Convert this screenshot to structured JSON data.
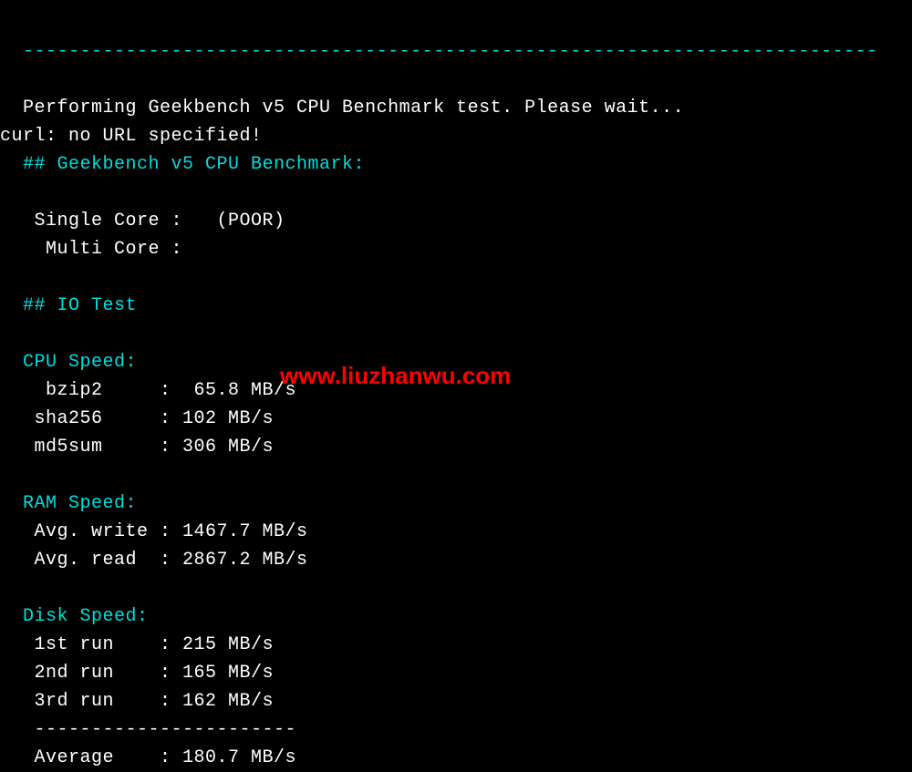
{
  "separator": "  ---------------------------------------------------------------------------",
  "intro": {
    "performing": "  Performing Geekbench v5 CPU Benchmark test. Please wait...",
    "curl_error": "curl: no URL specified!"
  },
  "sections": {
    "geekbench_header": "  ## Geekbench v5 CPU Benchmark:",
    "single_core_label": "   Single Core : ",
    "single_core_value": "  (POOR)",
    "multi_core_label": "    Multi Core : ",
    "multi_core_value": "",
    "io_test_header": "  ## IO Test",
    "cpu_speed_header": "  CPU Speed:",
    "cpu_bzip2_label": "    bzip2     : ",
    "cpu_bzip2_value": " 65.8 MB/s",
    "cpu_sha256_label": "   sha256     : ",
    "cpu_sha256_value": "102 MB/s",
    "cpu_md5sum_label": "   md5sum     : ",
    "cpu_md5sum_value": "306 MB/s",
    "ram_speed_header": "  RAM Speed:",
    "ram_write_label": "   Avg. write : ",
    "ram_write_value": "1467.7 MB/s",
    "ram_read_label": "   Avg. read  : ",
    "ram_read_value": "2867.2 MB/s",
    "disk_speed_header": "  Disk Speed:",
    "disk_1st_label": "   1st run    : ",
    "disk_1st_value": "215 MB/s",
    "disk_2nd_label": "   2nd run    : ",
    "disk_2nd_value": "165 MB/s",
    "disk_3rd_label": "   3rd run    : ",
    "disk_3rd_value": "162 MB/s",
    "disk_divider": "   -----------------------",
    "disk_avg_label": "   Average    : ",
    "disk_avg_value": "180.7 MB/s"
  },
  "watermark": "www.liuzhanwu.com"
}
